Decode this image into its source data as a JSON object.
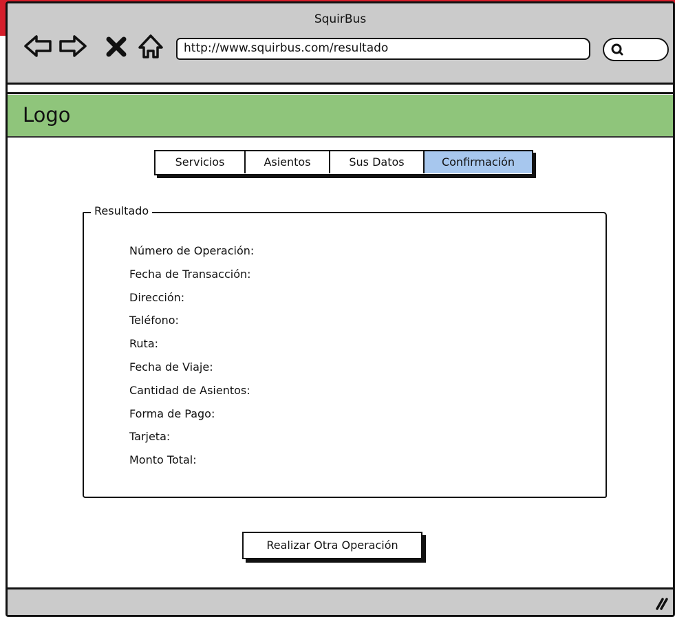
{
  "browser": {
    "title": "SquirBus",
    "url": "http://www.squirbus.com/resultado",
    "search_placeholder": "",
    "icons": {
      "back": "back-arrow-icon",
      "forward": "forward-arrow-icon",
      "stop": "close-icon",
      "home": "home-icon",
      "search": "search-icon",
      "resize": "resize-grip-icon"
    }
  },
  "header": {
    "logo": "Logo",
    "color": "#8fc57b"
  },
  "tabs": {
    "items": [
      {
        "label": "Servicios"
      },
      {
        "label": "Asientos"
      },
      {
        "label": "Sus Datos"
      },
      {
        "label": "Confirmación"
      }
    ],
    "active_index": 3,
    "active_color": "#a7c7ee"
  },
  "result": {
    "legend": "Resultado",
    "fields": [
      "Número de Operación:",
      "Fecha de Transacción:",
      "Dirección:",
      "Teléfono:",
      "Ruta:",
      "Fecha de Viaje:",
      "Cantidad de Asientos:",
      "Forma de Pago:",
      "Tarjeta:",
      "Monto Total:"
    ]
  },
  "actions": {
    "new_operation": "Realizar Otra Operación"
  }
}
